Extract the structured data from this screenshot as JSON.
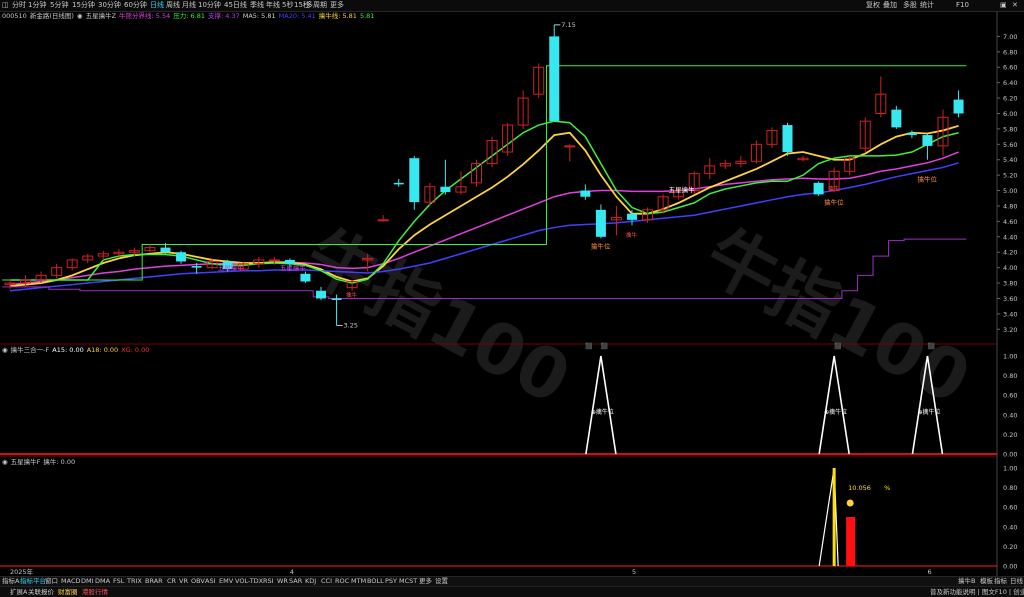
{
  "toolbar": {
    "left_icon": "grid-icon",
    "tabs": [
      "分时",
      "1分钟",
      "5分钟",
      "15分钟",
      "30分钟",
      "60分钟",
      "日线",
      "周线",
      "月线",
      "10分钟",
      "45日线",
      "季线",
      "年线",
      "5秒",
      "15秒",
      "多周期",
      "更多"
    ],
    "active_tab": "日线",
    "right_tabs": [
      "复权",
      "叠加",
      "多股",
      "统计",
      "F10"
    ],
    "right_icons": [
      "window-icon",
      "close-icon"
    ]
  },
  "main_legend": {
    "code": "000510",
    "name": "新金路(日线图)",
    "indicator": "五星擒牛Z",
    "items": [
      {
        "label": "牛熊分界线:",
        "value": "5.54",
        "color": "#e040e0"
      },
      {
        "label": "压力:",
        "value": "6.81",
        "color": "#3cf03c"
      },
      {
        "label": "支撑:",
        "value": "4.37",
        "color": "#b040e0"
      },
      {
        "label": "MA5:",
        "value": "5.81",
        "color": "#d0d0d0"
      },
      {
        "label": "MA20:",
        "value": "5.41",
        "color": "#4040ff"
      },
      {
        "label": "擒牛线:",
        "value": "5.81",
        "color": "#ffd23c"
      },
      {
        "label": "",
        "value": "5.81",
        "color": "#3cf03c"
      }
    ]
  },
  "sub1_legend": {
    "name": "擒牛三合一-F",
    "items": [
      {
        "label": "A15:",
        "value": "0.00",
        "color": "#ffffff"
      },
      {
        "label": "A18:",
        "value": "0.00",
        "color": "#ffd23c"
      },
      {
        "label": "XG:",
        "value": "0.00",
        "color": "#ff3030"
      }
    ]
  },
  "sub2_legend": {
    "name": "五星擒牛F",
    "items": [
      {
        "label": "擒牛:",
        "value": "0.00",
        "color": "#c8c8c8"
      }
    ]
  },
  "annotations": {
    "high_label": "7.15",
    "low_label": "3.25",
    "wxqn": "五星擒牛",
    "qnw": "擒牛位",
    "pct_value": "10.056",
    "pct_unit": "%",
    "arrow_up": "←7.15",
    "arrow_dn": "←3.25",
    "cq_tag": "擒牛",
    "bs_tag": "B",
    "s_tag": "S"
  },
  "chart_data": [
    {
      "type": "candlestick",
      "title": "新金路(日线图)",
      "ylim": [
        3.1,
        7.2
      ],
      "y_ticks": [
        "7.00",
        "6.80",
        "6.60",
        "6.40",
        "6.20",
        "6.00",
        "5.80",
        "5.60",
        "5.40",
        "5.20",
        "5.00",
        "4.80",
        "4.60",
        "4.40",
        "4.20",
        "4.00",
        "3.80",
        "3.60",
        "3.40",
        "3.20"
      ],
      "x_ticks": [
        "2025年",
        "4",
        "5",
        "6"
      ],
      "high": 7.15,
      "low": 3.25,
      "candles": [
        {
          "o": 3.78,
          "h": 3.85,
          "l": 3.72,
          "c": 3.8
        },
        {
          "o": 3.8,
          "h": 3.9,
          "l": 3.75,
          "c": 3.84
        },
        {
          "o": 3.84,
          "h": 3.95,
          "l": 3.8,
          "c": 3.9
        },
        {
          "o": 3.9,
          "h": 4.05,
          "l": 3.86,
          "c": 4.0
        },
        {
          "o": 4.0,
          "h": 4.12,
          "l": 3.96,
          "c": 4.1
        },
        {
          "o": 4.1,
          "h": 4.18,
          "l": 4.06,
          "c": 4.15
        },
        {
          "o": 4.15,
          "h": 4.22,
          "l": 4.1,
          "c": 4.18
        },
        {
          "o": 4.18,
          "h": 4.24,
          "l": 4.14,
          "c": 4.2
        },
        {
          "o": 4.2,
          "h": 4.26,
          "l": 4.15,
          "c": 4.22
        },
        {
          "o": 4.22,
          "h": 4.3,
          "l": 4.2,
          "c": 4.26
        },
        {
          "o": 4.26,
          "h": 4.32,
          "l": 4.18,
          "c": 4.2
        },
        {
          "o": 4.2,
          "h": 4.22,
          "l": 4.05,
          "c": 4.08
        },
        {
          "o": 4.02,
          "h": 4.06,
          "l": 3.92,
          "c": 4.0
        },
        {
          "o": 4.0,
          "h": 4.12,
          "l": 3.98,
          "c": 4.08
        },
        {
          "o": 4.08,
          "h": 4.1,
          "l": 3.95,
          "c": 3.98
        },
        {
          "o": 3.98,
          "h": 4.08,
          "l": 3.95,
          "c": 4.05
        },
        {
          "o": 4.05,
          "h": 4.14,
          "l": 4.0,
          "c": 4.1
        },
        {
          "o": 4.1,
          "h": 4.14,
          "l": 4.04,
          "c": 4.1
        },
        {
          "o": 4.1,
          "h": 4.12,
          "l": 4.0,
          "c": 4.05
        },
        {
          "o": 3.92,
          "h": 3.95,
          "l": 3.8,
          "c": 3.82
        },
        {
          "o": 3.7,
          "h": 3.75,
          "l": 3.58,
          "c": 3.6
        },
        {
          "o": 3.6,
          "h": 3.65,
          "l": 3.25,
          "c": 3.58
        },
        {
          "o": 3.74,
          "h": 3.84,
          "l": 3.7,
          "c": 3.82
        },
        {
          "o": 4.1,
          "h": 4.18,
          "l": 3.95,
          "c": 4.12
        },
        {
          "o": 4.62,
          "h": 4.68,
          "l": 4.6,
          "c": 4.62
        },
        {
          "o": 5.1,
          "h": 5.15,
          "l": 5.05,
          "c": 5.08
        },
        {
          "o": 5.42,
          "h": 5.45,
          "l": 4.75,
          "c": 4.85
        },
        {
          "o": 4.85,
          "h": 5.1,
          "l": 4.8,
          "c": 5.05
        },
        {
          "o": 5.05,
          "h": 5.4,
          "l": 4.95,
          "c": 4.98
        },
        {
          "o": 4.98,
          "h": 5.25,
          "l": 4.95,
          "c": 5.05
        },
        {
          "o": 5.1,
          "h": 5.4,
          "l": 5.05,
          "c": 5.35
        },
        {
          "o": 5.35,
          "h": 5.7,
          "l": 5.3,
          "c": 5.65
        },
        {
          "o": 5.5,
          "h": 5.88,
          "l": 5.45,
          "c": 5.85
        },
        {
          "o": 5.85,
          "h": 6.3,
          "l": 5.8,
          "c": 6.2
        },
        {
          "o": 6.25,
          "h": 6.65,
          "l": 6.2,
          "c": 6.6
        },
        {
          "o": 7.0,
          "h": 7.15,
          "l": 5.9,
          "c": 5.9
        },
        {
          "o": 5.58,
          "h": 5.6,
          "l": 5.38,
          "c": 5.58
        },
        {
          "o": 5.0,
          "h": 5.08,
          "l": 4.88,
          "c": 4.92
        },
        {
          "o": 4.75,
          "h": 4.82,
          "l": 4.38,
          "c": 4.4
        },
        {
          "o": 4.62,
          "h": 4.8,
          "l": 4.42,
          "c": 4.65
        },
        {
          "o": 4.7,
          "h": 4.75,
          "l": 4.55,
          "c": 4.62
        },
        {
          "o": 4.62,
          "h": 4.78,
          "l": 4.58,
          "c": 4.75
        },
        {
          "o": 4.75,
          "h": 4.95,
          "l": 4.7,
          "c": 4.92
        },
        {
          "o": 4.92,
          "h": 5.05,
          "l": 4.88,
          "c": 5.0
        },
        {
          "o": 5.0,
          "h": 5.25,
          "l": 4.95,
          "c": 5.22
        },
        {
          "o": 5.22,
          "h": 5.42,
          "l": 5.15,
          "c": 5.32
        },
        {
          "o": 5.32,
          "h": 5.4,
          "l": 5.28,
          "c": 5.35
        },
        {
          "o": 5.35,
          "h": 5.45,
          "l": 5.3,
          "c": 5.38
        },
        {
          "o": 5.38,
          "h": 5.65,
          "l": 5.35,
          "c": 5.6
        },
        {
          "o": 5.6,
          "h": 5.82,
          "l": 5.55,
          "c": 5.78
        },
        {
          "o": 5.85,
          "h": 5.88,
          "l": 5.45,
          "c": 5.5
        },
        {
          "o": 5.4,
          "h": 5.45,
          "l": 5.38,
          "c": 5.42
        },
        {
          "o": 5.1,
          "h": 5.12,
          "l": 4.93,
          "c": 4.95
        },
        {
          "o": 5.0,
          "h": 5.3,
          "l": 4.98,
          "c": 5.25
        },
        {
          "o": 5.25,
          "h": 5.45,
          "l": 5.2,
          "c": 5.42
        },
        {
          "o": 5.55,
          "h": 5.95,
          "l": 5.5,
          "c": 5.9
        },
        {
          "o": 6.0,
          "h": 6.48,
          "l": 5.95,
          "c": 6.25
        },
        {
          "o": 6.05,
          "h": 6.1,
          "l": 5.8,
          "c": 5.82
        },
        {
          "o": 5.75,
          "h": 5.78,
          "l": 5.68,
          "c": 5.72
        },
        {
          "o": 5.72,
          "h": 5.74,
          "l": 5.4,
          "c": 5.58
        },
        {
          "o": 5.58,
          "h": 6.05,
          "l": 5.45,
          "c": 5.95
        },
        {
          "o": 6.18,
          "h": 6.3,
          "l": 5.95,
          "c": 6.0
        }
      ],
      "lines": [
        {
          "name": "牛熊分界线",
          "color": "#e040e0",
          "values": [
            3.78,
            3.8,
            3.82,
            3.84,
            3.87,
            3.9,
            3.93,
            3.95,
            3.98,
            4.0,
            4.02,
            4.03,
            4.04,
            4.05,
            4.05,
            4.05,
            4.06,
            4.07,
            4.07,
            4.06,
            4.04,
            4.0,
            3.99,
            4.0,
            4.05,
            4.12,
            4.2,
            4.28,
            4.36,
            4.44,
            4.52,
            4.6,
            4.68,
            4.76,
            4.84,
            4.92,
            4.97,
            4.99,
            5.0,
            5.0,
            4.99,
            4.99,
            4.99,
            5.0,
            5.02,
            5.05,
            5.08,
            5.1,
            5.12,
            5.14,
            5.15,
            5.16,
            5.15,
            5.15,
            5.16,
            5.2,
            5.25,
            5.28,
            5.32,
            5.36,
            5.42,
            5.5
          ]
        },
        {
          "name": "擒牛线",
          "color": "#ffd23c",
          "values": [
            3.76,
            3.78,
            3.8,
            3.84,
            3.9,
            3.98,
            4.06,
            4.12,
            4.16,
            4.18,
            4.2,
            4.18,
            4.14,
            4.1,
            4.08,
            4.06,
            4.06,
            4.07,
            4.07,
            4.04,
            3.98,
            3.88,
            3.82,
            3.86,
            4.02,
            4.24,
            4.42,
            4.56,
            4.68,
            4.8,
            4.92,
            5.04,
            5.18,
            5.34,
            5.52,
            5.72,
            5.75,
            5.52,
            5.2,
            4.92,
            4.7,
            4.7,
            4.76,
            4.84,
            4.94,
            5.04,
            5.12,
            5.2,
            5.28,
            5.38,
            5.48,
            5.5,
            5.45,
            5.4,
            5.4,
            5.48,
            5.6,
            5.7,
            5.75,
            5.74,
            5.78,
            5.84
          ]
        },
        {
          "name": "MA20",
          "color": "#4040ff",
          "values": [
            3.7,
            3.72,
            3.74,
            3.76,
            3.78,
            3.8,
            3.82,
            3.84,
            3.86,
            3.88,
            3.9,
            3.92,
            3.93,
            3.94,
            3.95,
            3.96,
            3.96,
            3.97,
            3.97,
            3.97,
            3.96,
            3.95,
            3.94,
            3.93,
            3.95,
            3.98,
            4.02,
            4.06,
            4.12,
            4.18,
            4.24,
            4.3,
            4.36,
            4.42,
            4.48,
            4.52,
            4.55,
            4.56,
            4.57,
            4.58,
            4.6,
            4.62,
            4.64,
            4.66,
            4.68,
            4.72,
            4.76,
            4.8,
            4.84,
            4.88,
            4.92,
            4.95,
            4.97,
            5.0,
            5.04,
            5.08,
            5.13,
            5.18,
            5.22,
            5.26,
            5.3,
            5.36
          ]
        },
        {
          "name": "压力",
          "color": "#3cf03c",
          "values": [
            3.84,
            3.84,
            3.84,
            3.84,
            3.84,
            3.84,
            4.1,
            4.15,
            4.17,
            4.17,
            4.17,
            4.15,
            4.1,
            4.05,
            4.03,
            4.03,
            4.05,
            4.06,
            4.05,
            4.03,
            3.96,
            3.85,
            3.8,
            3.85,
            4.05,
            4.35,
            4.6,
            4.82,
            5.0,
            5.15,
            5.3,
            5.45,
            5.6,
            5.75,
            5.85,
            5.9,
            5.88,
            5.7,
            5.35,
            5.0,
            4.78,
            4.7,
            4.72,
            4.78,
            4.84,
            4.96,
            5.02,
            5.06,
            5.1,
            5.12,
            5.12,
            5.2,
            5.35,
            5.42,
            5.45,
            5.45,
            5.45,
            5.46,
            5.5,
            5.6,
            5.7,
            5.75
          ]
        },
        {
          "name": "压力位",
          "color": "#3cf03c",
          "style": "step",
          "values": [
            3.84,
            3.84,
            3.84,
            3.84,
            3.84,
            3.84,
            3.84,
            3.84,
            3.84,
            4.3,
            4.3,
            4.3,
            4.3,
            4.3,
            4.3,
            4.3,
            4.3,
            4.3,
            4.3,
            4.3,
            4.3,
            4.3,
            4.3,
            4.3,
            4.3,
            4.3,
            4.3,
            4.3,
            4.3,
            4.3,
            4.3,
            4.3,
            4.3,
            4.3,
            4.3,
            6.62,
            6.62,
            6.62,
            6.62,
            6.62,
            6.62,
            6.62,
            6.62,
            6.62,
            6.62,
            6.62,
            6.62,
            6.62,
            6.62,
            6.62,
            6.62,
            6.62,
            6.62,
            6.62,
            6.62,
            6.62,
            6.62,
            6.62,
            6.62,
            6.62,
            6.62,
            6.62
          ]
        },
        {
          "name": "支撑",
          "color": "#9a30c0",
          "style": "step",
          "values": [
            3.75,
            3.75,
            3.75,
            3.72,
            3.72,
            3.7,
            3.7,
            3.7,
            3.7,
            3.7,
            3.7,
            3.7,
            3.7,
            3.7,
            3.7,
            3.7,
            3.7,
            3.7,
            3.7,
            3.7,
            3.62,
            3.6,
            3.6,
            3.6,
            3.6,
            3.6,
            3.6,
            3.6,
            3.6,
            3.6,
            3.6,
            3.6,
            3.6,
            3.6,
            3.6,
            3.6,
            3.6,
            3.6,
            3.6,
            3.6,
            3.6,
            3.6,
            3.6,
            3.6,
            3.6,
            3.6,
            3.6,
            3.6,
            3.6,
            3.6,
            3.6,
            3.6,
            3.6,
            3.6,
            3.7,
            3.9,
            4.15,
            4.35,
            4.37,
            4.37,
            4.37,
            4.37
          ]
        }
      ]
    },
    {
      "type": "line",
      "title": "擒牛三合一-F",
      "ylim": [
        0,
        1.0
      ],
      "y_ticks": [
        "1.00",
        "0.80",
        "0.60",
        "0.40",
        "0.20",
        "0.00"
      ],
      "spikes_at": [
        38,
        53,
        59
      ],
      "series": [
        {
          "name": "A15",
          "color": "#ffffff"
        },
        {
          "name": "XG",
          "color": "#ff3030"
        }
      ]
    },
    {
      "type": "bar",
      "title": "五星擒牛F",
      "ylim": [
        0,
        1.0
      ],
      "y_ticks": [
        "1.00",
        "0.80",
        "0.60",
        "0.40",
        "0.20",
        "0.00"
      ],
      "spike_at": 53,
      "bar_value": 0.5
    }
  ],
  "bottom_tabs": [
    "指标A",
    "指标平台",
    "窗口",
    "MACD",
    "DMI",
    "DMA",
    "FSL",
    "TRIX",
    "BRAR",
    "CR",
    "VR",
    "OBV",
    "ASI",
    "EMV",
    "VOL-TDX",
    "RSI",
    "WR",
    "SAR",
    "KDJ",
    "CCI",
    "ROC",
    "MTM",
    "BOLL",
    "PSY",
    "MCST",
    "更多",
    "设置"
  ],
  "bottom_active": "指标平台",
  "bottom_right": [
    "擒牛B",
    "模板",
    "指标",
    "日线"
  ],
  "status": {
    "left": [
      "扩展A",
      "关联报价",
      "财富圈",
      "港股行情"
    ],
    "right": "普及新功能说明 | 图文F10 | 创业板"
  }
}
